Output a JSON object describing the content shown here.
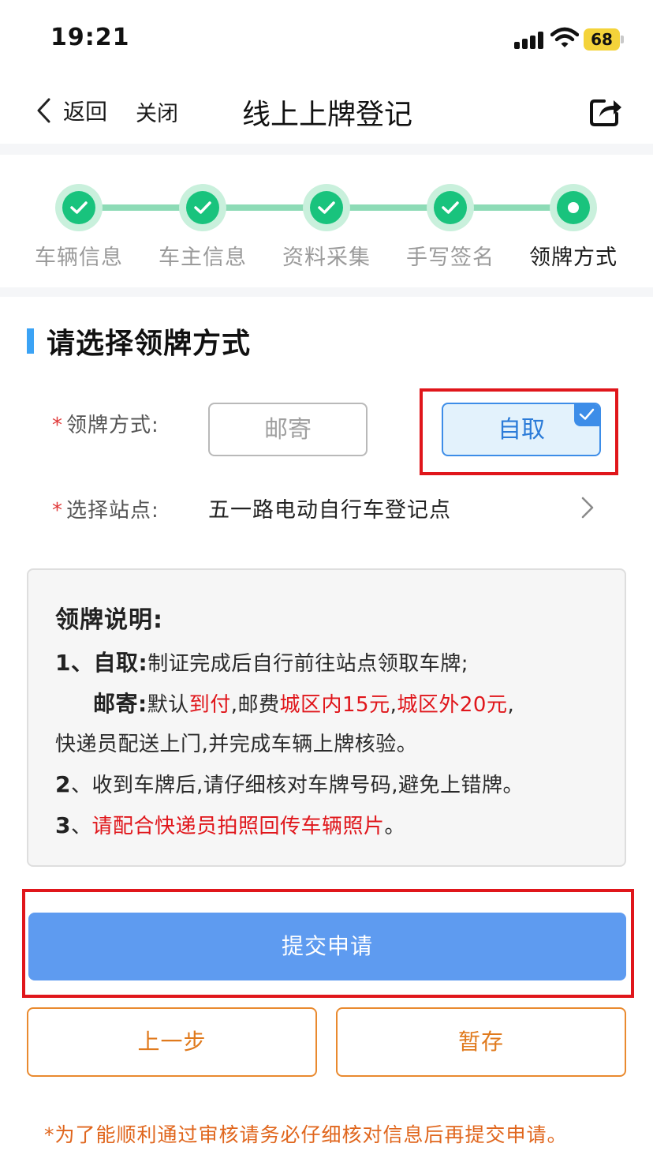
{
  "status_bar": {
    "time": "19:21",
    "battery_level": "68",
    "battery_color": "#f4d33a"
  },
  "nav": {
    "back_label": "返回",
    "close_label": "关闭",
    "title": "线上上牌登记",
    "share_icon": "share-icon"
  },
  "stepper": {
    "steps": [
      {
        "label": "车辆信息",
        "status": "done"
      },
      {
        "label": "车主信息",
        "status": "done"
      },
      {
        "label": "资料采集",
        "status": "done"
      },
      {
        "label": "手写签名",
        "status": "done"
      },
      {
        "label": "领牌方式",
        "status": "current"
      }
    ],
    "accent_color": "#19c37d"
  },
  "section": {
    "title": "请选择领牌方式"
  },
  "form": {
    "method_label": "领牌方式:",
    "required_mark": "*",
    "options": [
      {
        "label": "邮寄",
        "selected": false
      },
      {
        "label": "自取",
        "selected": true
      }
    ],
    "station_label": "选择站点:",
    "station_value": "五一路电动自行车登记点"
  },
  "notice": {
    "title": "领牌说明:",
    "line1_prefix": "1、",
    "line1_bold": "自取:",
    "line1_text": "制证完成后自行前往站点领取车牌;",
    "line2_bold": "邮寄:",
    "line2_a": "默认",
    "line2_red1": "到付",
    "line2_b": ",邮费",
    "line2_red2": "城区内15元",
    "line2_c": ",",
    "line2_red3": "城区外20元",
    "line2_d": ",",
    "line3_text": "快递员配送上门,并完成车辆上牌核验。",
    "line4_prefix": "2",
    "line4_text": "、收到车牌后,请仔细核对车牌号码,避免上错牌。",
    "line5_prefix": "3",
    "line5_sep": "、",
    "line5_red": "请配合快递员拍照回传车辆照片",
    "line5_end": "。"
  },
  "buttons": {
    "submit": "提交申请",
    "prev": "上一步",
    "save": "暂存",
    "submit_color": "#5e9bf0",
    "secondary_color": "#e98a2f"
  },
  "footer": {
    "note": "*为了能顺利通过审核请务必仔细核对信息后再提交申请。"
  }
}
